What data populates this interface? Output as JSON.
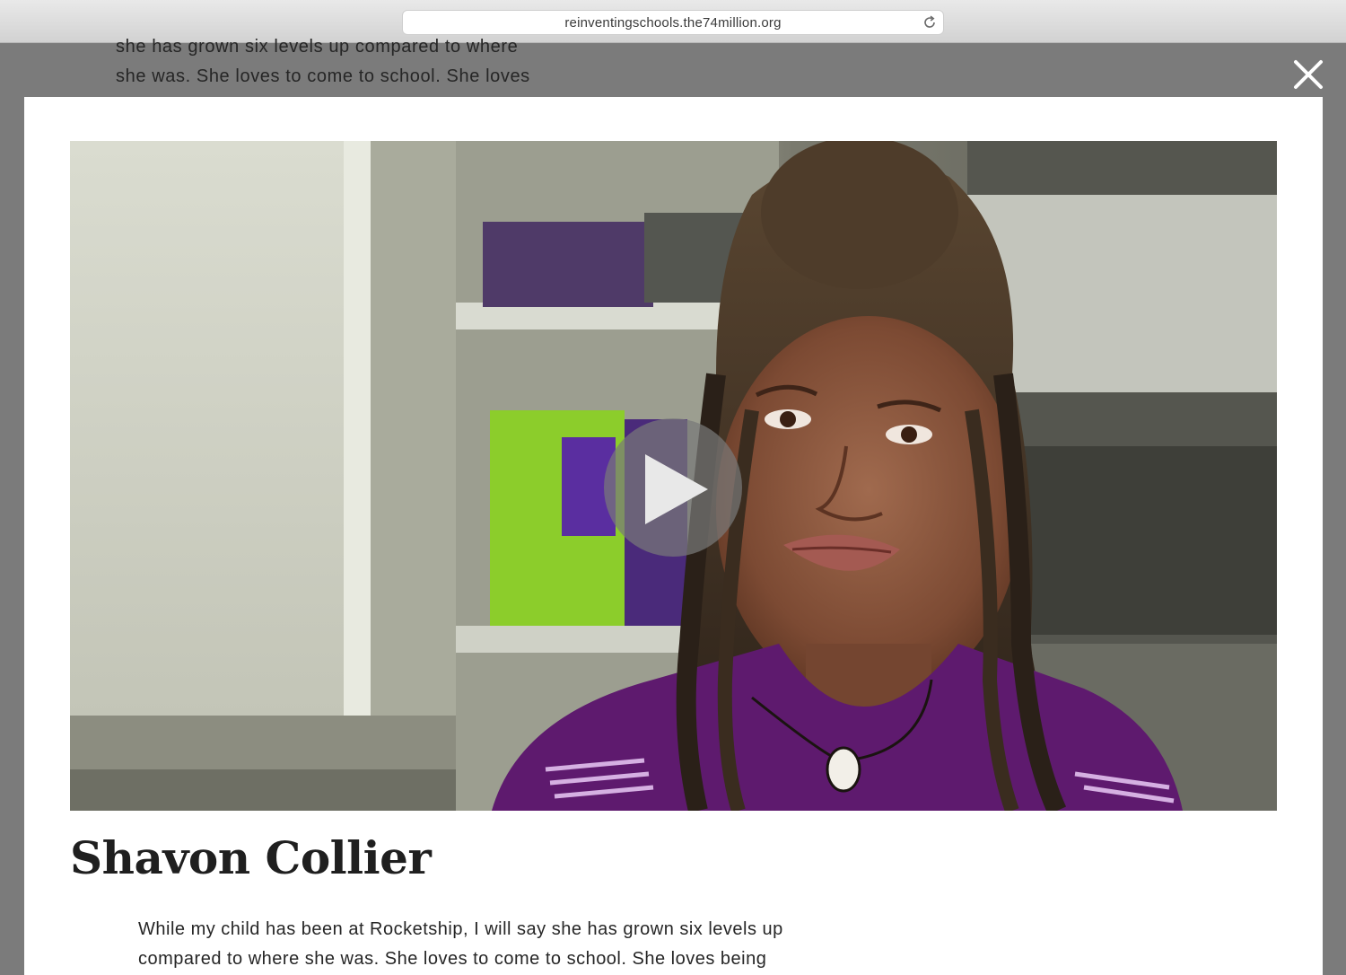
{
  "browser": {
    "url": "reinventingschools.the74million.org"
  },
  "background_page": {
    "lines": [
      "she has grown six levels up compared to where",
      "she was. She loves to come to school. She loves"
    ]
  },
  "modal": {
    "close_icon": "close-icon",
    "video": {
      "play_icon": "play-icon",
      "accent_colors": {
        "shirt": "#5e1a6e",
        "folder_green": "#8fd22a",
        "folder_purple": "#5a2ea0"
      }
    },
    "person_name": "Shavon Collier",
    "quote_lines": [
      "While my child has been at Rocketship, I will say she has grown six levels up",
      "compared to where she was. She loves to come to school. She loves being"
    ]
  }
}
